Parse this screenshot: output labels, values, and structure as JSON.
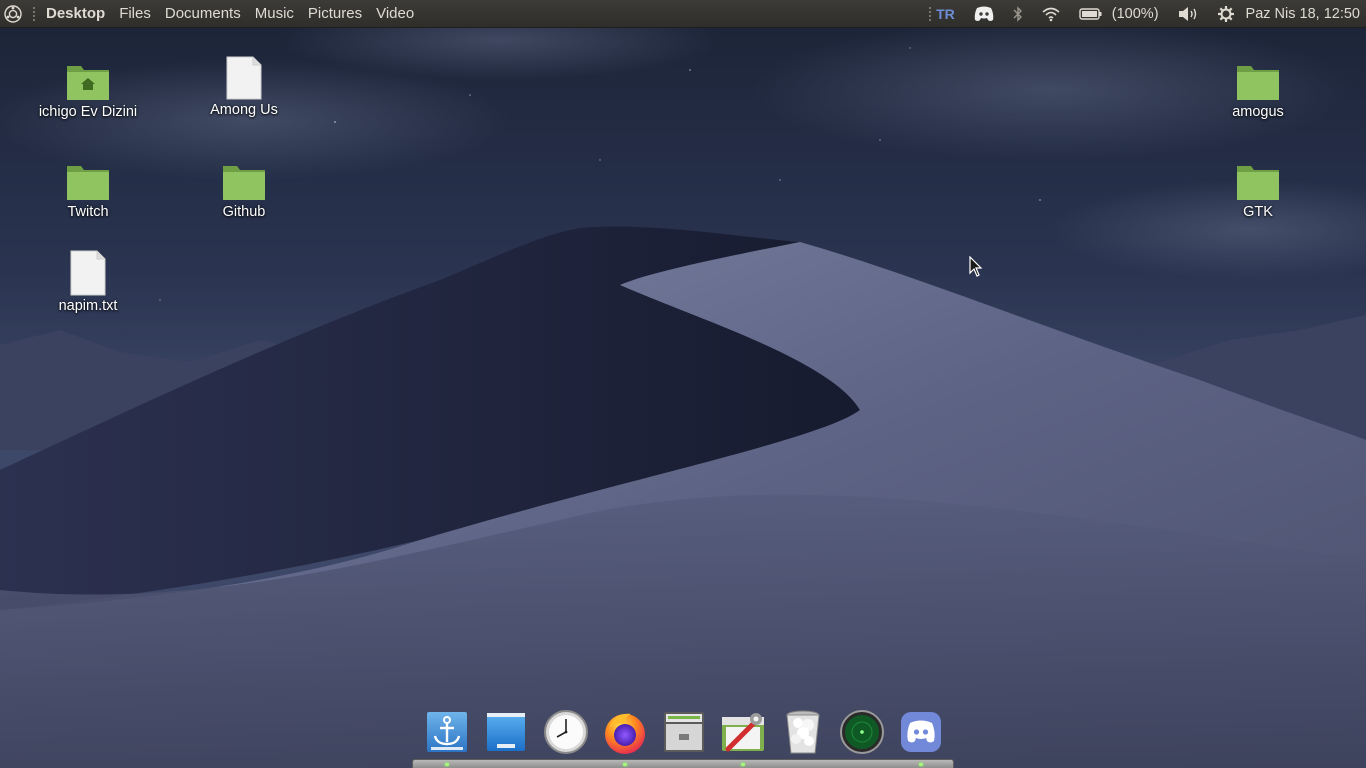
{
  "top_panel": {
    "menu": [
      "Desktop",
      "Files",
      "Documents",
      "Music",
      "Pictures",
      "Video"
    ],
    "keyboard_layout": "TR",
    "battery": "(100%)",
    "datetime": "Paz Nis 18, 12:50"
  },
  "desktop": {
    "icons": [
      {
        "label": "ichigo Ev Dizini",
        "icon": "home-folder-icon"
      },
      {
        "label": "Among Us",
        "icon": "file-icon"
      },
      {
        "label": "Twitch",
        "icon": "folder-icon"
      },
      {
        "label": "Github",
        "icon": "folder-icon"
      },
      {
        "label": "napim.txt",
        "icon": "text-file-icon"
      },
      {
        "label": "amogus",
        "icon": "folder-icon"
      },
      {
        "label": "GTK",
        "icon": "folder-icon"
      }
    ]
  },
  "dock": {
    "items": [
      {
        "icon": "dock-anchor-icon",
        "running": true
      },
      {
        "icon": "desktop-icon",
        "running": false
      },
      {
        "icon": "clock-icon",
        "running": false
      },
      {
        "icon": "firefox-icon",
        "running": true
      },
      {
        "icon": "file-cabinet-icon",
        "running": false
      },
      {
        "icon": "system-tools-icon",
        "running": true
      },
      {
        "icon": "trash-icon",
        "running": false
      },
      {
        "icon": "radar-icon",
        "running": false
      },
      {
        "icon": "discord-icon",
        "running": true
      }
    ]
  },
  "colors": {
    "panel": "#3c3b37",
    "folder_green": "#8bbf5e",
    "sky": "#2b3550",
    "dune": "#6b7190"
  }
}
